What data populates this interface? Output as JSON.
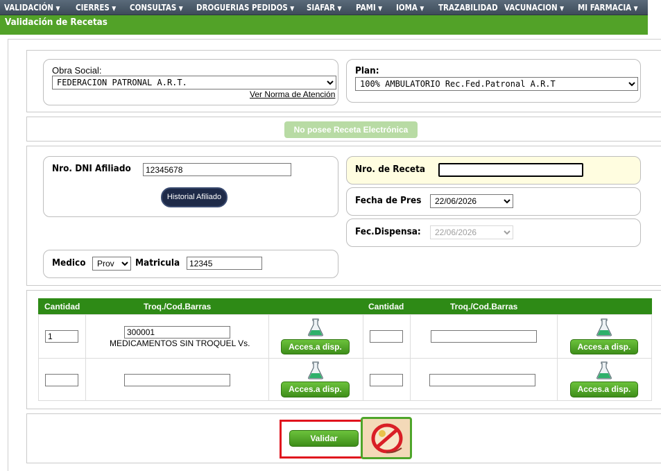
{
  "menu": [
    {
      "label": "VALIDACIÓN"
    },
    {
      "label": "CIERRES"
    },
    {
      "label": "CONSULTAS"
    },
    {
      "label": "DROGUERIAS PEDIDOS"
    },
    {
      "label": "SIAFAR"
    },
    {
      "label": "PAMI"
    },
    {
      "label": "IOMA"
    },
    {
      "label": "TRAZABILIDAD"
    },
    {
      "label": "VACUNACION"
    },
    {
      "label": "MI FARMACIA"
    }
  ],
  "page_title": "Validación de Recetas",
  "obra_social": {
    "label": "Obra Social:",
    "value": "FEDERACION PATRONAL A.R.T.",
    "norma_link": "Ver Norma de Atención"
  },
  "plan": {
    "label": "Plan:",
    "value": "100% AMBULATORIO Rec.Fed.Patronal A.R.T"
  },
  "receta_electronica_button": "No posee Receta Electrónica",
  "afiliado": {
    "dni_label": "Nro. DNI Afiliado",
    "dni_value": "12345678",
    "historial_button": "Historial Afiliado"
  },
  "receta": {
    "nro_label": "Nro. de Receta",
    "nro_value": "",
    "fecha_pres_label": "Fecha de Pres",
    "fecha_pres_value": "22/06/2026",
    "fec_dispensa_label": "Fec.Dispensa:",
    "fec_dispensa_value": "22/06/2026"
  },
  "medico": {
    "label": "Medico",
    "tipo_value": "Prov",
    "matricula_label": "Matricula",
    "matricula_value": "12345"
  },
  "items_table": {
    "headers": {
      "cantidad_1": "Cantidad",
      "troq_1": "Troq./Cod.Barras",
      "cantidad_2": "Cantidad",
      "troq_2": "Troq./Cod.Barras"
    },
    "acces_button": "Acces.a disp.",
    "rows": [
      {
        "left": {
          "cantidad": "1",
          "troquel": "300001",
          "descripcion": "MEDICAMENTOS SIN TROQUEL Vs."
        },
        "right": {
          "cantidad": "",
          "troquel": ""
        }
      },
      {
        "left": {
          "cantidad": "",
          "troquel": ""
        },
        "right": {
          "cantidad": "",
          "troquel": ""
        }
      }
    ]
  },
  "validar_button": "Validar",
  "icons": {
    "flask": "flask-icon",
    "no_sign_badge": "prohibited-stamp-icon"
  },
  "colors": {
    "menu_bg": "#4a5a6a",
    "title_bar": "#52a228",
    "table_header": "#2e8a16",
    "button_green": "#4ea52a",
    "highlight_red": "#e0131d",
    "receta_bg": "#fffde0"
  }
}
